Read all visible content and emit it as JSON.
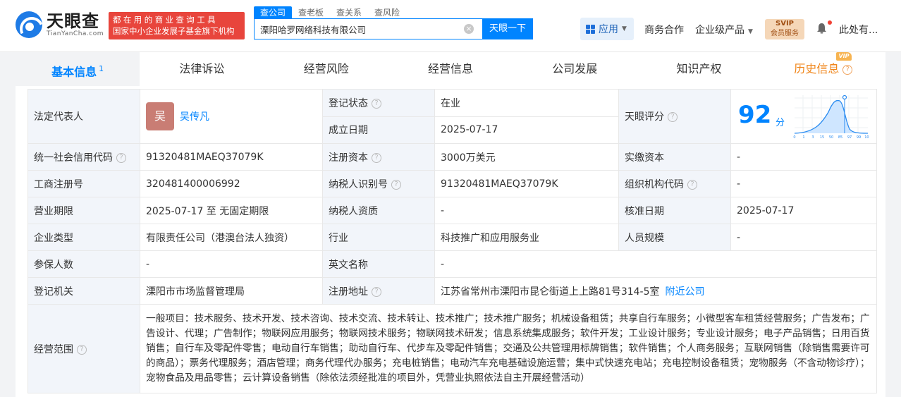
{
  "header": {
    "logo_name": "天眼查",
    "logo_url": "TianYanCha.com",
    "slogan_line1": "都在用的商业查询工具",
    "slogan_line2": "国家中小企业发展子基金旗下机构",
    "search_tabs": [
      "查公司",
      "查老板",
      "查关系",
      "查风险"
    ],
    "search_value": "溧阳哈罗网络科技有限公司",
    "search_button": "天眼一下",
    "app_button": "应用",
    "nav_business": "商务合作",
    "nav_enterprise": "企业级产品",
    "svip_line1": "SVIP",
    "svip_line2": "会员服务",
    "user": "此处有..."
  },
  "tabs": [
    {
      "label": "基本信息",
      "count": "1"
    },
    {
      "label": "法律诉讼"
    },
    {
      "label": "经营风险"
    },
    {
      "label": "经营信息"
    },
    {
      "label": "公司发展"
    },
    {
      "label": "知识产权"
    },
    {
      "label": "历史信息"
    }
  ],
  "vip_badge": "VIP",
  "info": {
    "legal_rep_label": "法定代表人",
    "legal_rep_avatar": "吴",
    "legal_rep_name": "吴传凡",
    "reg_status_label": "登记状态",
    "reg_status": "在业",
    "found_date_label": "成立日期",
    "found_date": "2025-07-17",
    "score_label": "天眼评分",
    "score": "92",
    "score_unit": "分",
    "credit_code_label": "统一社会信用代码",
    "credit_code": "91320481MAEQ37079K",
    "reg_capital_label": "注册资本",
    "reg_capital": "3000万美元",
    "paid_capital_label": "实缴资本",
    "paid_capital": "-",
    "biz_reg_no_label": "工商注册号",
    "biz_reg_no": "320481400006992",
    "taxpayer_id_label": "纳税人识别号",
    "taxpayer_id": "91320481MAEQ37079K",
    "org_code_label": "组织机构代码",
    "org_code": "-",
    "biz_term_label": "营业期限",
    "biz_term": "2025-07-17 至 无固定期限",
    "taxpayer_qual_label": "纳税人资质",
    "taxpayer_qual": "-",
    "approval_date_label": "核准日期",
    "approval_date": "2025-07-17",
    "company_type_label": "企业类型",
    "company_type": "有限责任公司（港澳台法人独资）",
    "industry_label": "行业",
    "industry": "科技推广和应用服务业",
    "staff_size_label": "人员规模",
    "staff_size": "-",
    "insured_label": "参保人数",
    "insured": "-",
    "english_name_label": "英文名称",
    "english_name": "-",
    "authority_label": "登记机关",
    "authority": "溧阳市市场监督管理局",
    "address_label": "注册地址",
    "address": "江苏省常州市溧阳市昆仑街道上上路81号314-5室",
    "nearby_link": "附近公司",
    "scope_label": "经营范围",
    "scope": "一般项目：技术服务、技术开发、技术咨询、技术交流、技术转让、技术推广；技术推广服务；机械设备租赁；共享自行车服务；小微型客车租赁经营服务；广告发布；广告设计、代理；广告制作；物联网应用服务；物联网技术服务；物联网技术研发；信息系统集成服务；软件开发；工业设计服务；专业设计服务；电子产品销售；日用百货销售；自行车及零配件零售；电动自行车销售；助动自行车、代步车及零配件销售；交通及公共管理用标牌销售；软件销售；个人商务服务；互联网销售（除销售需要许可的商品）；票务代理服务；酒店管理；商务代理代办服务；充电桩销售；电动汽车充电基础设施运营；集中式快速充电站；充电控制设备租赁；宠物服务（不含动物诊疗）；宠物食品及用品零售；云计算设备销售（除依法须经批准的项目外，凭营业执照依法自主开展经营活动）"
  },
  "score_chart": {
    "x_ticks": [
      "0",
      "1",
      "3",
      "15",
      "50",
      "85",
      "97",
      "99",
      "100"
    ]
  }
}
